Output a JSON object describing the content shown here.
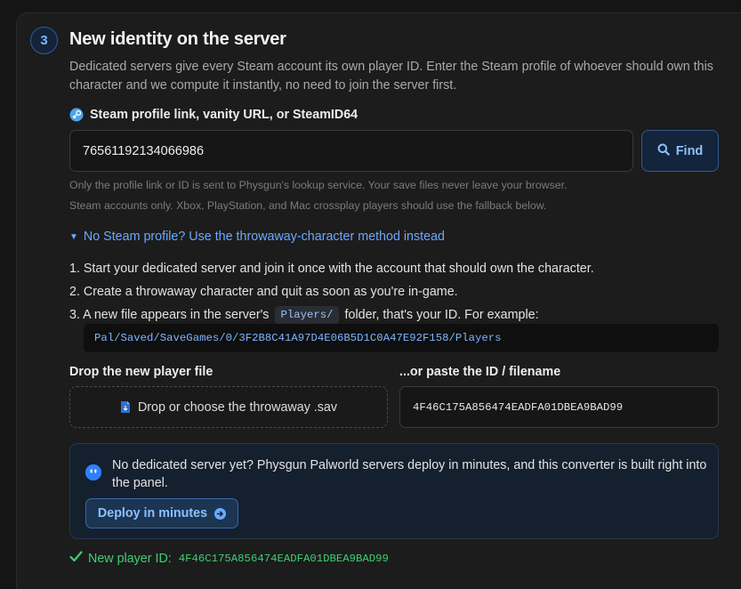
{
  "step": {
    "number": "3",
    "title": "New identity on the server",
    "description": "Dedicated servers give every Steam account its own player ID. Enter the Steam profile of whoever should own this character and we compute it instantly, no need to join the server first."
  },
  "steam_field": {
    "icon": "steam-icon",
    "label": "Steam profile link, vanity URL, or SteamID64",
    "value": "76561192134066986",
    "find_label": "Find",
    "hint_1": "Only the profile link or ID is sent to Physgun's lookup service. Your save files never leave your browser.",
    "hint_2": "Steam accounts only. Xbox, PlayStation, and Mac crossplay players should use the fallback below."
  },
  "fallback": {
    "toggle_label": "No Steam profile? Use the throwaway-character method instead",
    "step_1": "1. Start your dedicated server and join it once with the account that should own the character.",
    "step_2": "2. Create a throwaway character and quit as soon as you're in-game.",
    "step_3_before": "3. A new file appears in the server's",
    "step_3_code": "Players/",
    "step_3_after": "folder, that's your ID. For example:",
    "example_path": "Pal/Saved/SaveGames/0/3F2B8C41A97D4E06B5D1C0A47E92F158/Players",
    "drop_label": "Drop the new player file",
    "drop_text": "Drop or choose the throwaway .sav",
    "paste_label": "...or paste the ID / filename",
    "paste_value": "4F46C175A856474EADFA01DBEA9BAD99"
  },
  "promo": {
    "text": "No dedicated server yet? Physgun Palworld servers deploy in minutes, and this converter is built right into the panel.",
    "button_label": "Deploy in minutes"
  },
  "result": {
    "label": "New player ID:",
    "value": "4F46C175A856474EADFA01DBEA9BAD99"
  },
  "colors": {
    "accent": "#6aa9ff",
    "success": "#3ecf74",
    "background": "#1c1c1c"
  }
}
